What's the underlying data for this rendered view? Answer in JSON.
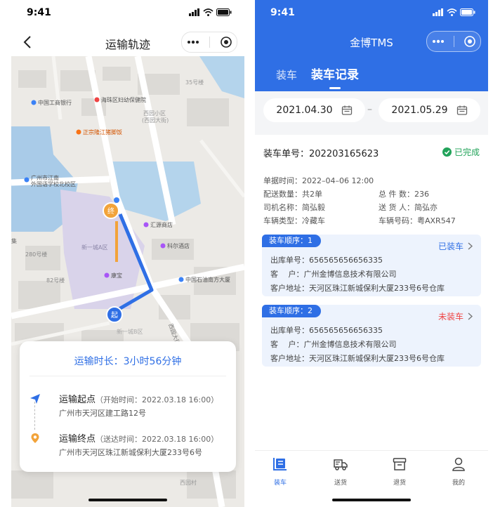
{
  "left": {
    "status": {
      "time": "9:41"
    },
    "nav": {
      "title": "运输轨迹"
    },
    "map": {
      "labels": {
        "bank": "中国工商银行",
        "hospital": "海珠区妇幼保健院",
        "building35": "35号楼",
        "community": "西园小区",
        "community_sub": "(西园大街)",
        "restaurant": "正宗隆江猪脚饭",
        "school1": "广州市江南",
        "school2": "外国语学校北校区",
        "shop": "汇源商店",
        "hotel": "科尔酒店",
        "kangbao": "康宝",
        "petro": "中国石油南方大厦",
        "zone": "新一城A区",
        "zone2": "新一城B区",
        "b280": "280号楼",
        "b82": "82号楼",
        "lane": "西园大街",
        "xiyuan": "西园村",
        "ji": "集"
      },
      "markers": {
        "start": "起",
        "end": "终"
      }
    },
    "card": {
      "duration": "运输时长：3小时56分钟",
      "start_label": "运输起点",
      "start_time": "（开始时间：2022.03.18 16:00）",
      "start_addr": "广州市天河区建工路12号",
      "end_label": "运输终点",
      "end_time": "（送达时间：2022.03.18 16:00）",
      "end_addr": "广州市天河区珠江新城保利大厦233号6号"
    }
  },
  "right": {
    "status": {
      "time": "9:41"
    },
    "header": {
      "title": "金博TMS",
      "tabs": [
        "装车",
        "装车记录"
      ]
    },
    "dates": {
      "from": "2021.04.30",
      "to": "2021.05.29",
      "dash": "–"
    },
    "order": {
      "no_label": "装车单号：",
      "no": "202203165623",
      "status": "已完成",
      "fields": {
        "time": "单据时间：2022–04–06 12:00",
        "qty": "配送数量：共2单",
        "pieces": "总 件 数：236",
        "driver": "司机名称：简弘毅",
        "consignor": "送 货 人：简弘亦",
        "vtype": "车辆类型：冷藏车",
        "plate": "车辆号码：粤AXR547"
      }
    },
    "sequences": [
      {
        "badge": "装车顺序：1",
        "state": "已装车",
        "state_color": "#2f6fe5",
        "out_no": "出库单号：656565656656335",
        "customer": "客　  户：广州金博信息技术有限公司",
        "address": "客户地址：天河区珠江新城保利大厦233号6号仓库"
      },
      {
        "badge": "装车顺序：2",
        "state": "未装车",
        "state_color": "#ef4444",
        "out_no": "出库单号：656565656656335",
        "customer": "客　  户：广州金博信息技术有限公司",
        "address": "客户地址：天河区珠江新城保利大厦233号6号仓库"
      }
    ],
    "tabbar": [
      {
        "label": "装车",
        "icon": "load-icon"
      },
      {
        "label": "送货",
        "icon": "truck-icon"
      },
      {
        "label": "退货",
        "icon": "return-box-icon"
      },
      {
        "label": "我的",
        "icon": "user-icon"
      }
    ],
    "accent": "#2f6fe5"
  }
}
